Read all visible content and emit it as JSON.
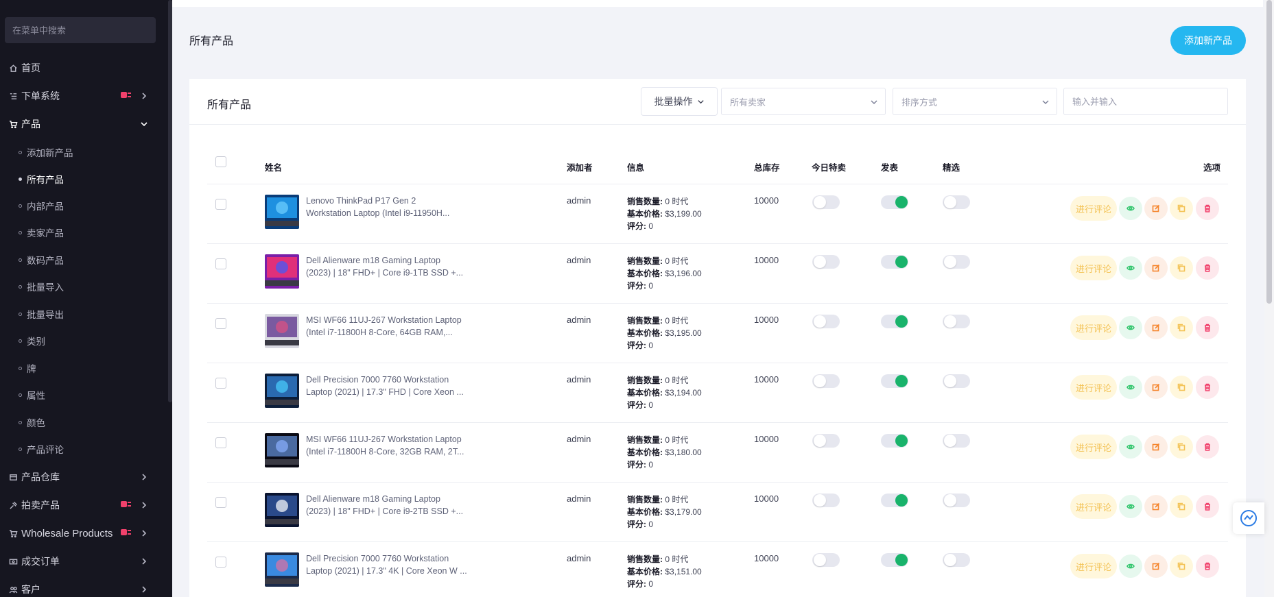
{
  "sidebar": {
    "search_placeholder": "在菜单中搜索",
    "items": [
      {
        "label": "首页",
        "icon": "home-icon"
      },
      {
        "label": "下单系统",
        "icon": "list-icon"
      },
      {
        "label": "产品",
        "icon": "cart-icon"
      },
      {
        "label": "产品仓库",
        "icon": "warehouse-icon"
      },
      {
        "label": "拍卖产品",
        "icon": "gavel-icon"
      },
      {
        "label": "Wholesale Products",
        "icon": "cart-icon"
      },
      {
        "label": "成交订单",
        "icon": "money-icon"
      },
      {
        "label": "客户",
        "icon": "users-icon"
      }
    ],
    "sub_items": [
      {
        "label": "添加新产品"
      },
      {
        "label": "所有产品"
      },
      {
        "label": "内部产品"
      },
      {
        "label": "卖家产品"
      },
      {
        "label": "数码产品"
      },
      {
        "label": "批量导入"
      },
      {
        "label": "批量导出"
      },
      {
        "label": "类别"
      },
      {
        "label": "牌"
      },
      {
        "label": "属性"
      },
      {
        "label": "颜色"
      },
      {
        "label": "产品评论"
      }
    ]
  },
  "page": {
    "title": "所有产品",
    "add_button": "添加新产品"
  },
  "card": {
    "title": "所有产品",
    "bulk_action": "批量操作",
    "seller_filter": "所有卖家",
    "sort_by": "排序方式",
    "search_placeholder": "输入并输入"
  },
  "table": {
    "headers": {
      "name": "姓名",
      "added_by": "添加者",
      "info": "信息",
      "stock": "总库存",
      "todays_deal": "今日特卖",
      "published": "发表",
      "featured": "精选",
      "options": "选项"
    },
    "info_labels": {
      "sales": "销售数量:",
      "price": "基本价格:",
      "rating": "评分:"
    },
    "review_label": "进行评论",
    "rows": [
      {
        "name1": "Lenovo ThinkPad P17 Gen 2",
        "name2": "Workstation Laptop (Intel i9-11950H...",
        "added_by": "admin",
        "sales": "0 时代",
        "price": "$3,199.00",
        "rating": "0",
        "stock": "10000",
        "deal": false,
        "published": true,
        "featured": false
      },
      {
        "name1": "Dell Alienware m18 Gaming Laptop",
        "name2": "(2023) | 18\" FHD+ | Core i9-1TB SSD +...",
        "added_by": "admin",
        "sales": "0 时代",
        "price": "$3,196.00",
        "rating": "0",
        "stock": "10000",
        "deal": false,
        "published": true,
        "featured": false
      },
      {
        "name1": "MSI WF66 11UJ-267 Workstation Laptop",
        "name2": "(Intel i7-11800H 8-Core, 64GB RAM,...",
        "added_by": "admin",
        "sales": "0 时代",
        "price": "$3,195.00",
        "rating": "0",
        "stock": "10000",
        "deal": false,
        "published": true,
        "featured": false
      },
      {
        "name1": "Dell Precision 7000 7760 Workstation",
        "name2": "Laptop (2021) | 17.3\" FHD | Core Xeon ...",
        "added_by": "admin",
        "sales": "0 时代",
        "price": "$3,194.00",
        "rating": "0",
        "stock": "10000",
        "deal": false,
        "published": true,
        "featured": false
      },
      {
        "name1": "MSI WF66 11UJ-267 Workstation Laptop",
        "name2": "(Intel i7-11800H 8-Core, 32GB RAM, 2T...",
        "added_by": "admin",
        "sales": "0 时代",
        "price": "$3,180.00",
        "rating": "0",
        "stock": "10000",
        "deal": false,
        "published": true,
        "featured": false
      },
      {
        "name1": "Dell Alienware m18 Gaming Laptop",
        "name2": "(2023) | 18\" FHD+ | Core i9-2TB SSD +...",
        "added_by": "admin",
        "sales": "0 时代",
        "price": "$3,179.00",
        "rating": "0",
        "stock": "10000",
        "deal": false,
        "published": true,
        "featured": false
      },
      {
        "name1": "Dell Precision 7000 7760 Workstation",
        "name2": "Laptop (2021) | 17.3\" 4K | Core Xeon W ...",
        "added_by": "admin",
        "sales": "0 时代",
        "price": "$3,151.00",
        "rating": "0",
        "stock": "10000",
        "deal": false,
        "published": true,
        "featured": false
      }
    ]
  },
  "colors": {
    "sidebar_bg": "#161620",
    "accent": "#25b7f0",
    "published_on": "#19b36b",
    "danger": "#f1416c"
  }
}
